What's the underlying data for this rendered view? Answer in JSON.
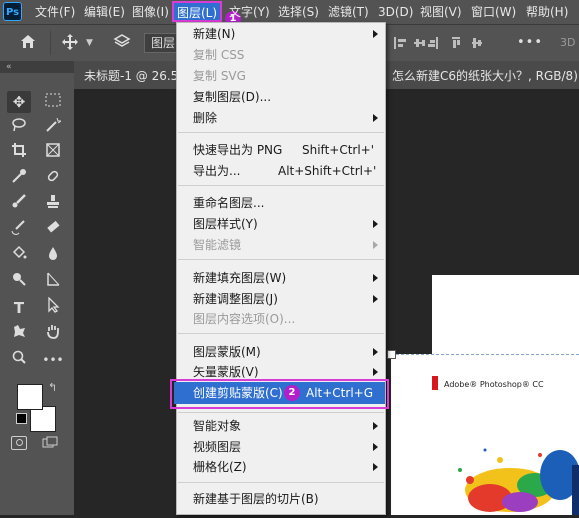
{
  "app": {
    "logo": "Ps"
  },
  "menubar": {
    "items": [
      "文件(F)",
      "编辑(E)",
      "图像(I)",
      "图层(L)",
      "文字(Y)",
      "选择(S)",
      "滤镜(T)",
      "3D(D)",
      "视图(V)",
      "窗口(W)",
      "帮助(H)"
    ],
    "active_index": 3,
    "badge_1": "1"
  },
  "optionsbar": {
    "home_icon": "home-icon",
    "move_icon": "move-icon",
    "layer_select": "图层",
    "more": "•••",
    "threed": "3D"
  },
  "document": {
    "tab_title_left": "未标题-1 @ 26.5",
    "tab_title_right": "怎么新建C6的纸张大小？, RGB/8) *",
    "image_caption": "Adobe® Photoshop® CC"
  },
  "toolbar": {
    "collapse": "«"
  },
  "layer_menu": {
    "groups": [
      [
        {
          "label": "新建(N)",
          "submenu": true,
          "disabled": false
        },
        {
          "label": "复制 CSS",
          "disabled": true
        },
        {
          "label": "复制 SVG",
          "disabled": true
        },
        {
          "label": "复制图层(D)...",
          "disabled": false
        },
        {
          "label": "删除",
          "submenu": true,
          "disabled": false
        }
      ],
      [
        {
          "label": "快速导出为 PNG",
          "shortcut": "Shift+Ctrl+'",
          "disabled": false
        },
        {
          "label": "导出为...",
          "shortcut": "Alt+Shift+Ctrl+'",
          "disabled": false
        }
      ],
      [
        {
          "label": "重命名图层...",
          "disabled": false
        },
        {
          "label": "图层样式(Y)",
          "submenu": true,
          "disabled": false
        },
        {
          "label": "智能滤镜",
          "submenu": true,
          "disabled": true
        }
      ],
      [
        {
          "label": "新建填充图层(W)",
          "submenu": true,
          "disabled": false
        },
        {
          "label": "新建调整图层(J)",
          "submenu": true,
          "disabled": false
        },
        {
          "label": "图层内容选项(O)...",
          "disabled": true
        }
      ],
      [
        {
          "label": "图层蒙版(M)",
          "submenu": true,
          "disabled": false
        },
        {
          "label": "矢量蒙版(V)",
          "submenu": true,
          "disabled": false
        },
        {
          "label": "创建剪贴蒙版(C)",
          "shortcut": "Alt+Ctrl+G",
          "highlighted": true,
          "badge": "2",
          "disabled": false
        }
      ],
      [
        {
          "label": "智能对象",
          "submenu": true,
          "disabled": false
        },
        {
          "label": "视频图层",
          "submenu": true,
          "disabled": false
        },
        {
          "label": "栅格化(Z)",
          "submenu": true,
          "disabled": false
        }
      ],
      [
        {
          "label": "新建基于图层的切片(B)",
          "disabled": false
        }
      ]
    ]
  },
  "colors": {
    "highlight": "#2f6fd0",
    "annotation": "#d93bd6",
    "badge": "#b21fc9"
  }
}
